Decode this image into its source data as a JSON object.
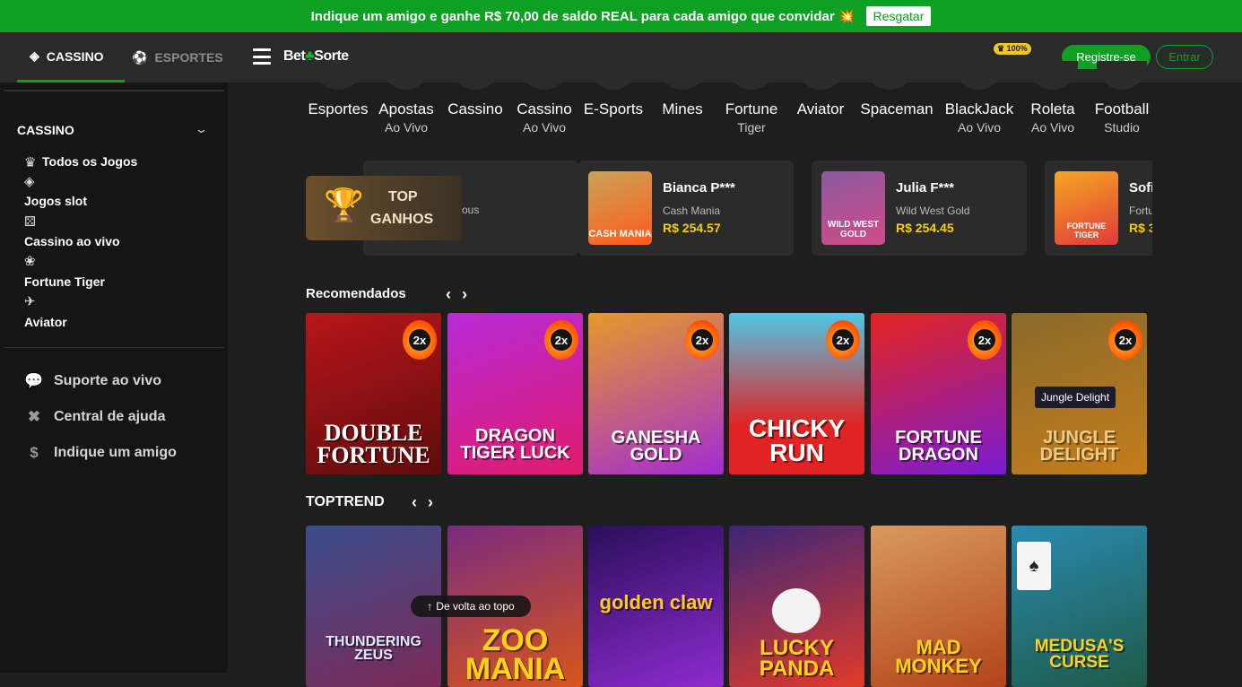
{
  "promo": {
    "text": "Indique um amigo e ganhe R$ 70,00 de saldo REAL para cada amigo que convidar 💥",
    "button": "Resgatar"
  },
  "topbar": {
    "tab_cassino": "CASSINO",
    "tab_esportes": "ESPORTES",
    "logo_left": "Bet",
    "logo_right": "Sorte",
    "badge": "100%",
    "register": "Registre-se",
    "login": "Entrar"
  },
  "sidebar": {
    "heading": "CASSINO",
    "items": [
      {
        "label": "Todos os Jogos",
        "icon": "crown-icon"
      },
      {
        "label": "Jogos slot",
        "icon": "slot-icon"
      },
      {
        "label": "Cassino ao vivo",
        "icon": "dice-icon"
      },
      {
        "label": "Fortune Tiger",
        "icon": "paw-icon"
      },
      {
        "label": "Aviator",
        "icon": "plane-icon"
      }
    ],
    "support": [
      {
        "label": "Suporte ao vivo",
        "icon": "chat-icon"
      },
      {
        "label": "Central de ajuda",
        "icon": "help-icon"
      },
      {
        "label": "Indique um amigo",
        "icon": "money-bag-icon"
      }
    ]
  },
  "categories": [
    {
      "l1": "Esportes",
      "l2": ""
    },
    {
      "l1": "Apostas",
      "l2": "Ao Vivo"
    },
    {
      "l1": "Cassino",
      "l2": ""
    },
    {
      "l1": "Cassino",
      "l2": "Ao Vivo"
    },
    {
      "l1": "E-Sports",
      "l2": ""
    },
    {
      "l1": "Mines",
      "l2": ""
    },
    {
      "l1": "Fortune",
      "l2": "Tiger"
    },
    {
      "l1": "Aviator",
      "l2": ""
    },
    {
      "l1": "Spaceman",
      "l2": ""
    },
    {
      "l1": "BlackJack",
      "l2": "Ao Vivo"
    },
    {
      "l1": "Roleta",
      "l2": "Ao Vivo"
    },
    {
      "l1": "Football",
      "l2": "Studio"
    }
  ],
  "top_ganhos": {
    "line1": "TOP",
    "line2": "GANHOS",
    "partial": "ous"
  },
  "winners": [
    {
      "name": "Bianca P***",
      "game": "Cash Mania",
      "amount": "R$ 254.57",
      "thumb_label": "CASH MANIA"
    },
    {
      "name": "Julia F***",
      "game": "Wild West Gold",
      "amount": "R$ 254.45",
      "thumb_label": "WILD WEST GOLD"
    },
    {
      "name": "Sofi",
      "game": "Fortu",
      "amount": "R$ 3",
      "thumb_label": "FORTUNE TIGER"
    }
  ],
  "recomendados": {
    "title": "Recomendados",
    "games": [
      {
        "name": "DOUBLE FORTUNE",
        "mult": "2x",
        "colors": [
          "#b8161a",
          "#5e0c0c"
        ]
      },
      {
        "name": "DRAGON TIGER LUCK",
        "mult": "2x",
        "colors": [
          "#b62ad7",
          "#e11b6d"
        ]
      },
      {
        "name": "GANESHA GOLD",
        "mult": "2x",
        "colors": [
          "#e59a2a",
          "#a32bd2"
        ]
      },
      {
        "name": "CHICKY RUN",
        "mult": "2x",
        "colors": [
          "#4fc7e6",
          "#e12323"
        ]
      },
      {
        "name": "FORTUNE DRAGON",
        "mult": "2x",
        "colors": [
          "#e3231f",
          "#7a1cd4"
        ]
      },
      {
        "name": "JUNGLE DELIGHT",
        "mult": "2x",
        "colors": [
          "#8a6a2b",
          "#c57d1c"
        ]
      }
    ],
    "tooltip": "Jungle Delight"
  },
  "toptrend": {
    "title": "TOPTREND",
    "games": [
      {
        "name": "THUNDERING ZEUS",
        "colors": [
          "#3b4d8c",
          "#7b2a57"
        ]
      },
      {
        "name": "ZOO MANIA",
        "colors": [
          "#7a2b7e",
          "#d8561a"
        ]
      },
      {
        "name": "golden claw",
        "colors": [
          "#2a0f5a",
          "#8e2bd0"
        ]
      },
      {
        "name": "LUCKY PANDA",
        "colors": [
          "#3b2677",
          "#e13a2a"
        ]
      },
      {
        "name": "MAD MONKEY",
        "colors": [
          "#d89a5e",
          "#b3431a"
        ]
      },
      {
        "name": "MEDUSA'S CURSE",
        "colors": [
          "#2a8ab0",
          "#1e5a48"
        ]
      }
    ]
  },
  "back_to_top": "De volta ao topo"
}
